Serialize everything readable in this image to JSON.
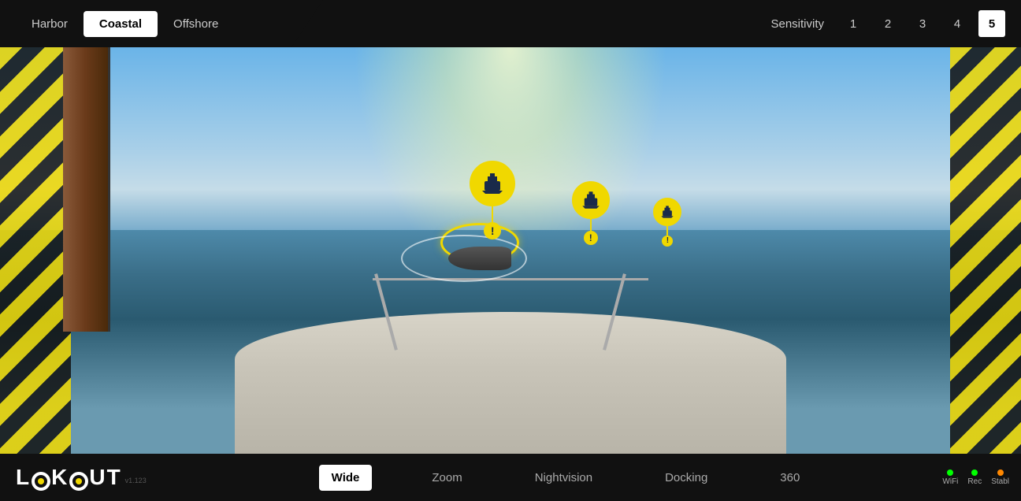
{
  "top_nav": {
    "modes": [
      {
        "id": "harbor",
        "label": "Harbor",
        "active": false
      },
      {
        "id": "coastal",
        "label": "Coastal",
        "active": true
      },
      {
        "id": "offshore",
        "label": "Offshore",
        "active": false
      }
    ],
    "sensitivity_label": "Sensitivity",
    "sensitivity_levels": [
      {
        "value": "1",
        "active": false
      },
      {
        "value": "2",
        "active": false
      },
      {
        "value": "3",
        "active": false
      },
      {
        "value": "4",
        "active": false
      },
      {
        "value": "5",
        "active": true
      }
    ]
  },
  "ship_markers": [
    {
      "id": "marker-1",
      "size": "large",
      "alert": "!"
    },
    {
      "id": "marker-2",
      "size": "medium",
      "alert": "!"
    },
    {
      "id": "marker-3",
      "size": "small",
      "alert": "!"
    }
  ],
  "bottom_nav": {
    "logo": "LOOKOUT",
    "version": "v1.123",
    "view_modes": [
      {
        "id": "wide",
        "label": "Wide",
        "active": true
      },
      {
        "id": "zoom",
        "label": "Zoom",
        "active": false
      },
      {
        "id": "nightvision",
        "label": "Nightvision",
        "active": false
      },
      {
        "id": "docking",
        "label": "Docking",
        "active": false
      },
      {
        "id": "360",
        "label": "360",
        "active": false
      }
    ],
    "status": [
      {
        "id": "wifi",
        "label": "WiFi",
        "color": "green"
      },
      {
        "id": "rec",
        "label": "Rec",
        "color": "green"
      },
      {
        "id": "stabl",
        "label": "Stabl",
        "color": "orange"
      }
    ]
  }
}
